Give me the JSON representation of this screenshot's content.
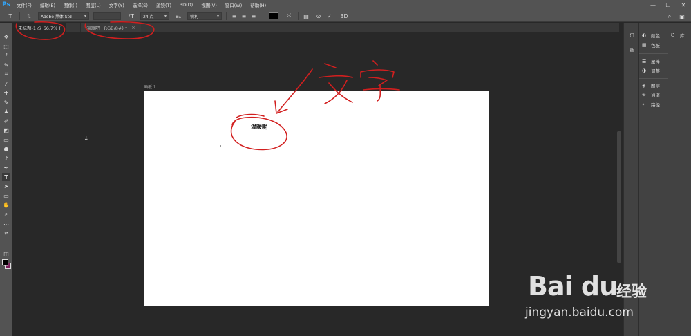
{
  "app": {
    "logo": "Ps"
  },
  "menu": [
    "文件(F)",
    "编辑(E)",
    "图像(I)",
    "图层(L)",
    "文字(Y)",
    "选择(S)",
    "滤镜(T)",
    "3D(D)",
    "视图(V)",
    "窗口(W)",
    "帮助(H)"
  ],
  "window_controls": {
    "minimize": "—",
    "maximize": "☐",
    "close": "✕"
  },
  "options": {
    "font_family": "Adobe 黑体 Std",
    "font_style": "",
    "font_size": "24 点",
    "antialias_label": "aₐ",
    "antialias": "锐利",
    "text_color": "#000000",
    "label_3d": "3D"
  },
  "tabs": [
    {
      "label": "未标题-1 @ 66.7% (",
      "active": true
    },
    {
      "label": "温暖吧 , RGB/8#) *",
      "active": false,
      "close": "×"
    }
  ],
  "canvas": {
    "artboard_label": "画板 1",
    "text_layer": "温暖呢",
    "background": "#ffffff"
  },
  "panels": {
    "group1": [
      {
        "icon": "palette-icon",
        "label": "颜色"
      },
      {
        "icon": "swatches-icon",
        "label": "色板"
      }
    ],
    "group2": [
      {
        "icon": "properties-icon",
        "label": "属性"
      },
      {
        "icon": "adjustments-icon",
        "label": "调整"
      }
    ],
    "group3": [
      {
        "icon": "layers-icon",
        "label": "图层"
      },
      {
        "icon": "channels-icon",
        "label": "通道"
      },
      {
        "icon": "paths-icon",
        "label": "路径"
      }
    ],
    "library": "库"
  },
  "annotation": {
    "handwritten": "文字",
    "color": "#d21f1f"
  },
  "watermark": {
    "brand": "Bai du",
    "product": "经验",
    "url": "jingyan.baidu.com"
  }
}
